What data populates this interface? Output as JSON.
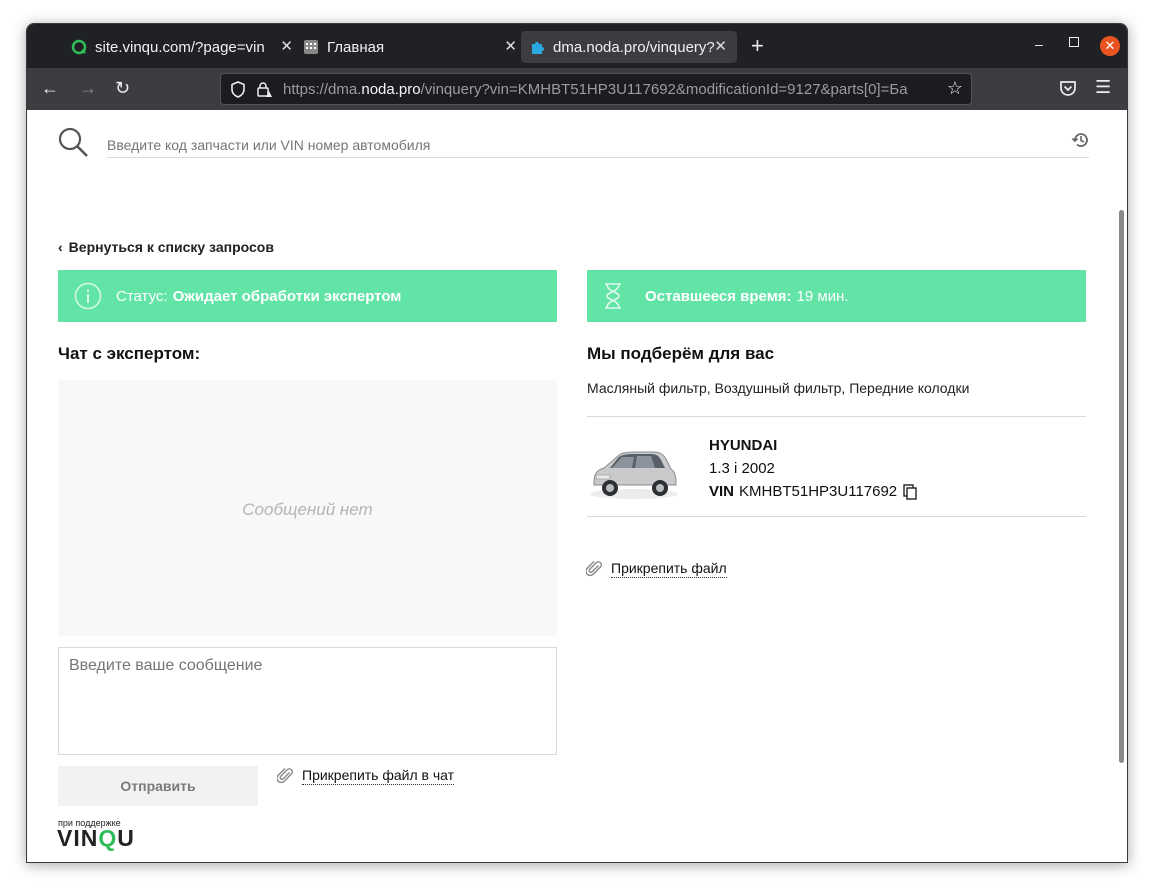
{
  "browser": {
    "tabs": [
      {
        "title": "site.vinqu.com/?page=vin",
        "active": false
      },
      {
        "title": "Главная",
        "active": false
      },
      {
        "title": "dma.noda.pro/vinquery?v",
        "active": true
      }
    ],
    "url_prefix": "https://dma.",
    "url_domain": "noda.pro",
    "url_rest": "/vinquery?vin=KMHBT51HP3U117692&modificationId=9127&parts[0]=Ба"
  },
  "search": {
    "placeholder": "Введите код запчасти или VIN номер автомобиля"
  },
  "back_link": "Вернуться к списку запросов",
  "status": {
    "label": "Статус:",
    "value": "Ожидает обработки экспертом"
  },
  "timer": {
    "label": "Оставшееся время:",
    "value": "19 мин."
  },
  "chat": {
    "title": "Чат с экспертом:",
    "empty_text": "Сообщений нет",
    "input_placeholder": "Введите ваше сообщение",
    "send_label": "Отправить",
    "attach_label": "Прикрепить файл в чат"
  },
  "picks": {
    "title": "Мы подберём для вас",
    "parts": "Масляный фильтр, Воздушный фильтр, Передние колодки"
  },
  "car": {
    "make": "HYUNDAI",
    "modification": "1.3 i 2002",
    "vin_label": "VIN",
    "vin": "KMHBT51HP3U117692"
  },
  "attach_file_label": "Прикрепить файл",
  "footer": {
    "caption": "при поддержке",
    "logo_part1": "VIN",
    "logo_q": "Q",
    "logo_part2": "U"
  },
  "colors": {
    "status_green": "#62e4a7",
    "brand_green": "#2ebd59"
  }
}
